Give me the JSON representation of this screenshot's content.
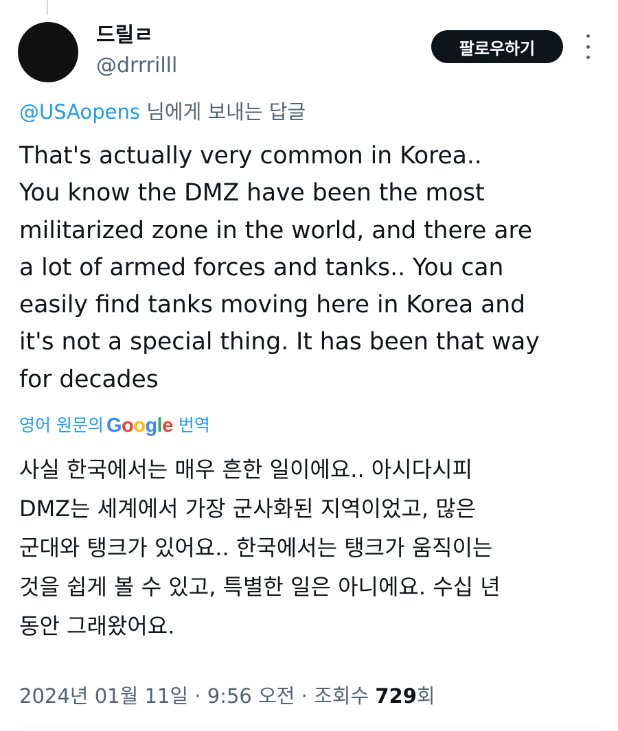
{
  "author": {
    "display_name": "드릴ㄹ",
    "handle": "@drrrilll"
  },
  "follow_button_label": "팔로우하기",
  "more_icon": "more-vertical-icon",
  "reply_context": {
    "mention": "@USAopens",
    "suffix": " 님에게 보내는 답글"
  },
  "tweet": {
    "lines": [
      "That's actually very common in Korea..",
      "You know the DMZ have been the most",
      "militarized zone in the world, and there are",
      "a lot of armed forces and tanks.. You can",
      "easily find tanks moving here in Korea and",
      "it's not a special thing. It has been that way",
      "for decades"
    ]
  },
  "translation": {
    "prefix": "영어 원문의",
    "google_letters": [
      "G",
      "o",
      "o",
      "g",
      "l",
      "e"
    ],
    "google_colors": [
      "#4285F4",
      "#EA4335",
      "#FBBC05",
      "#4285F4",
      "#34A853",
      "#EA4335"
    ],
    "suffix": "번역",
    "lines": [
      "사실 한국에서는 매우 흔한 일이에요.. 아시다시피",
      "DMZ는 세계에서 가장 군사화된 지역이었고, 많은",
      "군대와 탱크가 있어요.. 한국에서는 탱크가 움직이는",
      "것을 쉽게 볼 수 있고, 특별한 일은 아니에요. 수십 년",
      "동안 그래왔어요."
    ]
  },
  "meta": {
    "date": "2024년 01월 11일",
    "separator": " · ",
    "time": "9:56 오전",
    "views_label": "조회수 ",
    "views_count": "729",
    "views_suffix": "회"
  },
  "colors": {
    "link": "#1d9bf0",
    "secondary_text": "#536471",
    "primary_text": "#0f1419",
    "follow_button_bg": "#0f1419"
  }
}
